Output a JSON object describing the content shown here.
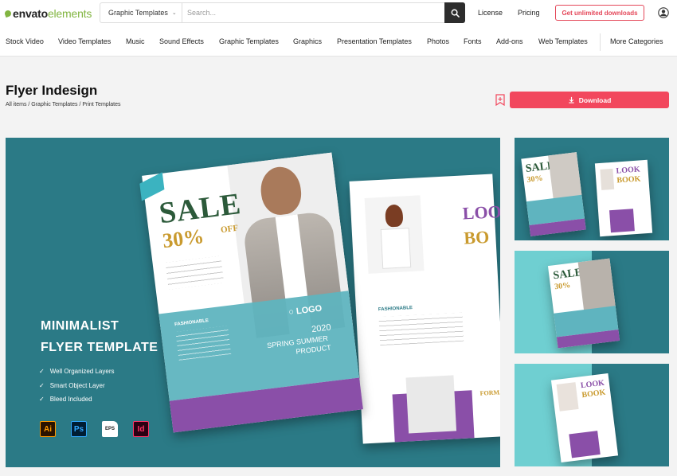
{
  "header": {
    "logo_part1": "envato",
    "logo_part2": "elements",
    "search_category": "Graphic Templates",
    "search_placeholder": "Search...",
    "license": "License",
    "pricing": "Pricing",
    "cta": "Get unlimited downloads"
  },
  "categories": [
    "Stock Video",
    "Video Templates",
    "Music",
    "Sound Effects",
    "Graphic Templates",
    "Graphics",
    "Presentation Templates",
    "Photos",
    "Fonts",
    "Add-ons",
    "Web Templates",
    "More Categories"
  ],
  "page": {
    "title": "Flyer Indesign",
    "breadcrumb": "All items / Graphic Templates / Print Templates",
    "download": "Download"
  },
  "preview": {
    "title_line1": "MINIMALIST",
    "title_line2": "FLYER TEMPLATE",
    "features": [
      "Well Organized Layers",
      "Smart Object Layer",
      "Bleed Included"
    ],
    "apps": [
      "Ai",
      "Ps",
      "EPS",
      "Id"
    ],
    "flyer": {
      "sale": "SALE",
      "pct": "30%",
      "off": "OFF",
      "logo": "LOGO",
      "year": "2020",
      "season": "SPRING SUMMER",
      "product": "PRODUCT",
      "fashionable": "FASHIONABLE",
      "look": "LOO",
      "book": "BO",
      "formal": "FORMA"
    }
  },
  "thumbs": {
    "sale": "SALE",
    "pct": "30%",
    "look": "LOOK",
    "book": "BOOK"
  },
  "colors": {
    "teal": "#2b7a86",
    "light_teal": "#6fcfd1",
    "accent": "#f2475d",
    "purple": "#8a4fa8",
    "gold": "#c99a2e"
  }
}
